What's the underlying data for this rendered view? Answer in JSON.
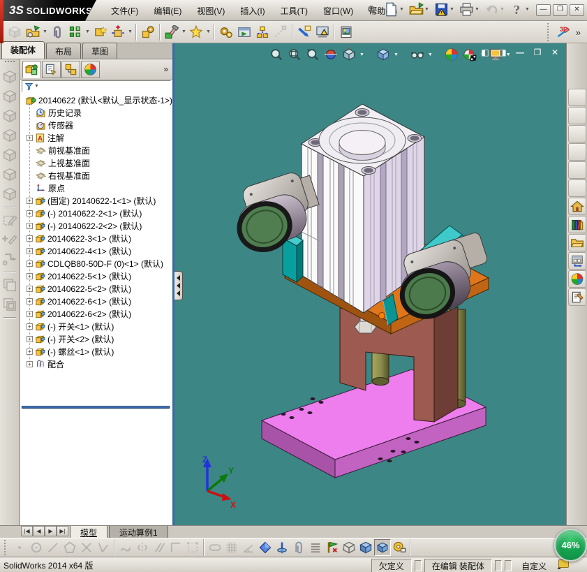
{
  "colors": {
    "viewport_bg": "#3d8686",
    "accent_red": "#c02010",
    "base_pink": "#ee7dee",
    "frame_brown": "#9c5a50",
    "plate_orange": "#e0761a",
    "teal_bracket": "#0a9f9f"
  },
  "titlebar": {
    "brand_mark": "3S",
    "brand": "SOLIDWORKS",
    "menus": [
      "文件(F)",
      "编辑(E)",
      "视图(V)",
      "插入(I)",
      "工具(T)",
      "窗口(W)",
      "帮助(H)"
    ],
    "search_icon": "search",
    "window_buttons": [
      {
        "icon": "win-min",
        "glyph": "—"
      },
      {
        "icon": "win-restore",
        "glyph": "❐"
      },
      {
        "icon": "win-close",
        "glyph": "✕"
      }
    ]
  },
  "quick_tools": [
    {
      "icon": "new-doc",
      "dropdown": true
    },
    {
      "icon": "open-folder",
      "dropdown": true
    },
    {
      "icon": "save",
      "dropdown": true
    },
    {
      "icon": "print",
      "dropdown": true
    },
    {
      "icon": "undo",
      "dropdown": true,
      "disabled": true
    },
    {
      "icon": "help",
      "dropdown": true
    }
  ],
  "assembly_toolbar": [
    {
      "icon": "insert-component",
      "disabled": true
    },
    {
      "icon": "open2",
      "dropdown": true
    },
    {
      "icon": "mate"
    },
    {
      "icon": "pattern",
      "dropdown": true
    },
    {
      "icon": "fasteners"
    },
    {
      "icon": "move",
      "dropdown": true
    },
    {
      "sep": true
    },
    {
      "icon": "asm-features"
    },
    {
      "sep": true
    },
    {
      "icon": "edit-comp",
      "dropdown": true
    },
    {
      "icon": "smart-comp",
      "dropdown": true
    },
    {
      "sep": true
    },
    {
      "icon": "gears"
    },
    {
      "icon": "motion"
    },
    {
      "icon": "exploded"
    },
    {
      "icon": "explode-sketch",
      "disabled": true
    },
    {
      "sep": true
    },
    {
      "icon": "interference"
    },
    {
      "icon": "visualize"
    },
    {
      "sep": true
    },
    {
      "icon": "photo"
    }
  ],
  "toolbar_right": {
    "sketch_icon": "3d-sketch",
    "overflow": "»"
  },
  "panel": {
    "tabs": [
      {
        "label": "装配体",
        "active": true
      },
      {
        "label": "布局"
      },
      {
        "label": "草图"
      }
    ],
    "manager_tabs": [
      {
        "icon": "fm-tree",
        "active": true
      },
      {
        "icon": "fm-properties"
      },
      {
        "icon": "fm-config"
      },
      {
        "icon": "fm-display"
      }
    ],
    "overflow": "»",
    "filter_icon": "funnel",
    "tree": [
      {
        "icon": "assembly",
        "label": "20140622 (默认<默认_显示状态-1>)",
        "root": true
      },
      {
        "icon": "history",
        "label": "历史记录"
      },
      {
        "icon": "sensors",
        "label": "传感器"
      },
      {
        "icon": "annotations",
        "label": "注解",
        "plus": true
      },
      {
        "icon": "plane",
        "label": "前视基准面"
      },
      {
        "icon": "plane",
        "label": "上视基准面"
      },
      {
        "icon": "plane",
        "label": "右视基准面"
      },
      {
        "icon": "origin",
        "label": "原点"
      },
      {
        "icon": "component",
        "label": "(固定) 20140622-1<1> (默认)",
        "plus": true
      },
      {
        "icon": "component",
        "label": "(-) 20140622-2<1> (默认)",
        "plus": true
      },
      {
        "icon": "component",
        "label": "(-) 20140622-2<2> (默认)",
        "plus": true
      },
      {
        "icon": "component",
        "label": "20140622-3<1> (默认)",
        "plus": true
      },
      {
        "icon": "component",
        "label": "20140622-4<1> (默认)",
        "plus": true
      },
      {
        "icon": "component",
        "label": "CDLQB80-50D-F (0)<1> (默认)",
        "plus": true
      },
      {
        "icon": "component",
        "label": "20140622-5<1> (默认)",
        "plus": true
      },
      {
        "icon": "component",
        "label": "20140622-5<2> (默认)",
        "plus": true
      },
      {
        "icon": "component",
        "label": "20140622-6<1> (默认)",
        "plus": true
      },
      {
        "icon": "component",
        "label": "20140622-6<2> (默认)",
        "plus": true
      },
      {
        "icon": "component",
        "label": "(-) 开关<1> (默认)",
        "plus": true
      },
      {
        "icon": "component",
        "label": "(-) 开关<2> (默认)",
        "plus": true
      },
      {
        "icon": "component",
        "label": "(-) 螺丝<1> (默认)",
        "plus": true
      },
      {
        "icon": "mates",
        "label": "配合",
        "plus": true
      }
    ]
  },
  "viewport": {
    "headsup": [
      {
        "icon": "zoom-fit"
      },
      {
        "icon": "zoom-area"
      },
      {
        "icon": "previous-view"
      },
      {
        "icon": "section-view"
      },
      {
        "icon": "view-orientation",
        "dropdown": true
      },
      {
        "gap": true
      },
      {
        "icon": "display-style",
        "dropdown": true
      },
      {
        "gap": true
      },
      {
        "icon": "hide-show",
        "dropdown": true
      },
      {
        "gap": true
      },
      {
        "icon": "edit-appearance"
      },
      {
        "icon": "apply-scene",
        "dropdown": true
      },
      {
        "icon": "view-settings",
        "dropdown": true
      }
    ],
    "window_buttons": [
      {
        "glyph": "◧"
      },
      {
        "glyph": "◨"
      },
      {
        "glyph": "—"
      },
      {
        "glyph": "❐"
      },
      {
        "glyph": "✕"
      }
    ],
    "triad": {
      "x": "X",
      "y": "Y",
      "z": "Z"
    }
  },
  "task_pane": [
    {
      "icon": "home"
    },
    {
      "icon": "design-library"
    },
    {
      "icon": "file-explorer"
    },
    {
      "icon": "view-palette"
    },
    {
      "icon": "appearances"
    },
    {
      "icon": "custom-properties"
    }
  ],
  "bottom_tabs": {
    "nav": [
      "|◀",
      "◀",
      "▶",
      "▶|"
    ],
    "tabs": [
      {
        "label": "模型",
        "active": true
      },
      {
        "label": "运动算例1"
      }
    ]
  },
  "bottom_toolbar": [
    {
      "icon": "sk-point",
      "disabled": true
    },
    {
      "icon": "sk-circle",
      "disabled": true
    },
    {
      "icon": "sk-line",
      "disabled": true
    },
    {
      "icon": "sk-polygon",
      "disabled": true
    },
    {
      "icon": "sk-cross",
      "disabled": true
    },
    {
      "icon": "sk-angle",
      "disabled": true
    },
    {
      "sep": true
    },
    {
      "icon": "sk-spline",
      "disabled": true
    },
    {
      "icon": "sk-mirror",
      "disabled": true
    },
    {
      "icon": "sk-parallel",
      "disabled": true
    },
    {
      "icon": "sk-corner",
      "disabled": true
    },
    {
      "icon": "sk-points",
      "disabled": true
    },
    {
      "sep": true
    },
    {
      "icon": "sk-slot",
      "disabled": true
    },
    {
      "icon": "sk-grid",
      "disabled": true
    },
    {
      "icon": "sk-angle-dim",
      "disabled": true
    },
    {
      "icon": "blue-diamond"
    },
    {
      "icon": "blue-pin"
    },
    {
      "icon": "clip"
    },
    {
      "icon": "hlines"
    },
    {
      "icon": "flag"
    },
    {
      "icon": "cube-wire"
    },
    {
      "icon": "cube-blue"
    },
    {
      "icon": "cube-blue",
      "pressed": true
    },
    {
      "icon": "tape"
    },
    {
      "sep": true
    }
  ],
  "status_bar": {
    "left": "SolidWorks 2014 x64 版",
    "cells": [
      "欠定义",
      "在编辑 装配体"
    ],
    "custom": "自定义"
  },
  "badge": {
    "value": "46%"
  }
}
